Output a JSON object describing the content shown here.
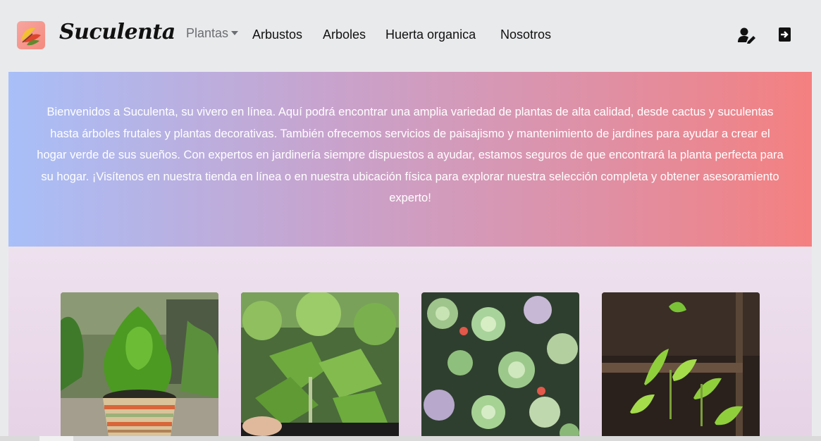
{
  "navbar": {
    "brand": "Suculenta",
    "links": [
      {
        "label": "Plantas",
        "dropdown": true
      },
      {
        "label": "Arbustos"
      },
      {
        "label": "Arboles"
      },
      {
        "label": "Huerta organica"
      },
      {
        "label": "Nosotros"
      }
    ],
    "icons": [
      "user-edit-icon",
      "sign-in-icon"
    ]
  },
  "hero": {
    "text": "Bienvenidos a Suculenta, su vivero en línea. Aquí podrá encontrar una amplia variedad de plantas de alta calidad, desde cactus y suculentas hasta árboles frutales y plantas decorativas. También ofrecemos servicios de paisajismo y mantenimiento de jardines para ayudar a crear el hogar verde de sus sueños. Con expertos en jardinería siempre dispuestos a ayudar, estamos seguros de que encontrará la planta perfecta para su hogar. ¡Visítenos en nuestra tienda en línea o en nuestra ubicación física para explorar nuestra selección completa y obtener asesoramiento experto!"
  },
  "gallery": {
    "cards": [
      {
        "image": "potted-cypress-photo"
      },
      {
        "image": "seedlings-photo"
      },
      {
        "image": "succulents-photo"
      },
      {
        "image": "pepper-seedlings-photo"
      }
    ]
  },
  "colors": {
    "hero_start": "#a8bff8",
    "hero_end": "#f48080",
    "navbar_bg": "#e9eaec"
  }
}
